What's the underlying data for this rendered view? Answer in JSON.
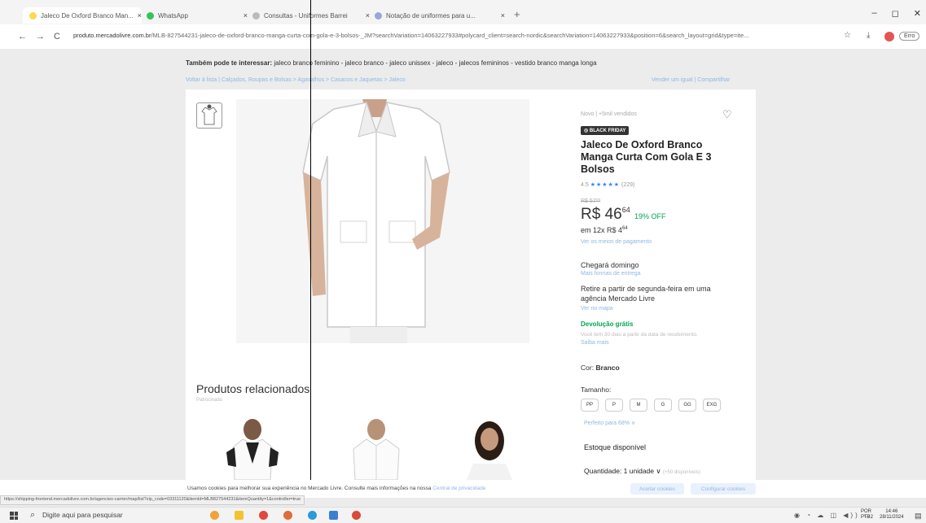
{
  "browser": {
    "tabs": [
      {
        "label": "Jaleco De Oxford Branco Man...",
        "active": true
      },
      {
        "label": "WhatsApp"
      },
      {
        "label": "Consultas - Uniformes Barrei"
      },
      {
        "label": "Notação de uniformes para u..."
      }
    ],
    "tab_close": "×",
    "new_tab": "+",
    "window_buttons": {
      "minimize": "–",
      "maximize": "◻",
      "close": "✕"
    },
    "nav": {
      "back": "←",
      "forward": "→",
      "reload": "C"
    },
    "url_domain": "produto.mercadolivre.com.br",
    "url_rest": "/MLB-827544231-jaleco-de-oxford-branco-manga-curta-com-gola-e-3-bolsos-_JM?searchVariation=14063227933#polycard_client=search-nordic&searchVariation=14063227933&position=6&search_layout=grid&type=ite...",
    "star_icon": "☆",
    "download_icon": "⤓",
    "error_label": "Erro"
  },
  "page": {
    "suggest_prefix": "Também pode te interessar:",
    "suggest_items": "jaleco branco feminino - jaleco branco - jaleco unissex - jaleco - jalecos femininos - vestido branco manga longa",
    "breadcrumb": "Voltar à lista  |  Calçados, Roupas e Bolsas > Agasalhos > Casacos e Jaquetas > Jaleco",
    "top_links": "Vender um igual  |  Compartilhar",
    "product": {
      "condition": "Novo  |  +5mil vendidos",
      "badge": "◎ BLACK FRIDAY",
      "title": "Jaleco De Oxford Branco Manga Curta Com Gola E 3 Bolsos",
      "rating_value": "4.5",
      "stars": "★★★★★",
      "rating_count": "(229)",
      "old_price": "R$ 57⁰⁰",
      "price_main": "R$ 46",
      "price_cents": "64",
      "discount": "19% OFF",
      "installment_prefix": "em 12x R$ 4",
      "installment_cents": "64",
      "payment_link": "Ver os meios de pagamento",
      "arrival": "Chegará domingo",
      "delivery_link": "Mais formas de entrega",
      "pickup": "Retire a partir de segunda-feira em uma agência Mercado Livre",
      "map_link": "Ver no mapa",
      "return_label": "Devolução grátis",
      "return_desc": "Você tem 30 dias a partir da data de recebimento.",
      "more_link": "Saiba mais",
      "color_label": "Cor:",
      "color_value": "Branco",
      "size_label": "Tamanho:",
      "sizes": [
        "PP",
        "P",
        "M",
        "G",
        "GG",
        "EXG"
      ],
      "fit_link": "Perfeito para 68% ∨",
      "stock_label": "Estoque disponível",
      "quantity_label": "Quantidade: 1 unidade ∨",
      "quantity_available": "(+50 disponíveis)"
    },
    "related_title": "Produtos relacionados",
    "related_sub": "Patrocinado"
  },
  "cookie": {
    "text": "Usamos cookies para melhorar sua experiência no Mercado Livre. Consulte mais informações na nossa",
    "link": "Central de privacidade",
    "accept": "Aceitar cookies",
    "configure": "Configurar cookies"
  },
  "status_url": "https://shipping-frontend.mercadolivre.com.br/agencies-carrier/map/list?zip_code=03311120&itemId=MLB827544231&itemQuantity=1&controller=true",
  "taskbar": {
    "search_icon": "⌕",
    "search_placeholder": "Digite aqui para pesquisar",
    "tray_icons": "◉ ◔ ☁ ◫ ◀)) ▭",
    "lang_1": "POR",
    "lang_2": "PTB2",
    "time": "14:46",
    "date": "28/11/2024",
    "notification_icon": "▤"
  },
  "colors": {
    "mercado_blue": "#3483fa",
    "discount_green": "#00a650",
    "link_blue": "#8fb7e6"
  }
}
